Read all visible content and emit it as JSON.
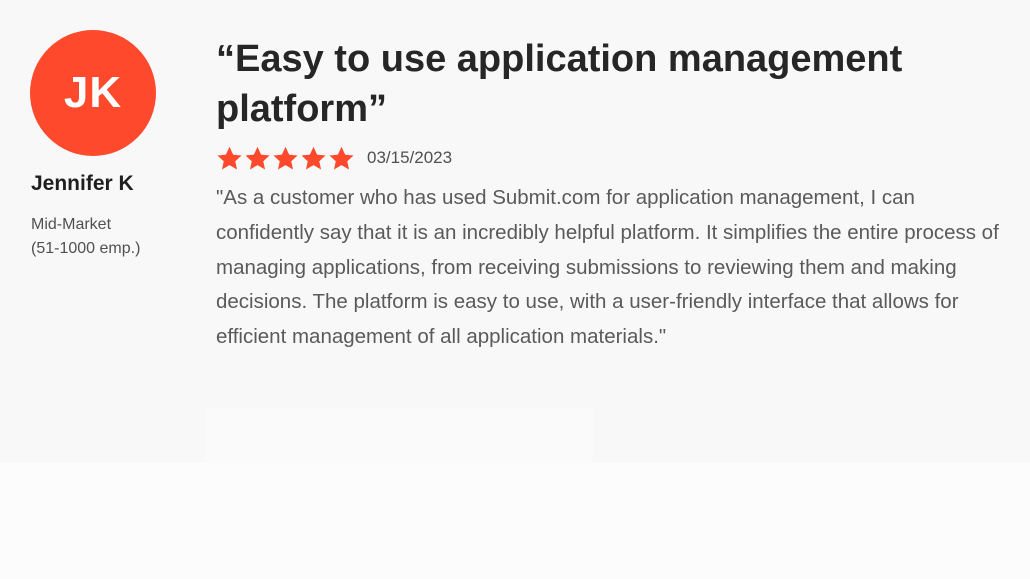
{
  "reviewer": {
    "initials": "JK",
    "name": "Jennifer K",
    "segment": "Mid-Market",
    "company_size": "(51-1000 emp.)",
    "avatar_color": "#ff492c"
  },
  "review": {
    "title": "“Easy to use application management platform”",
    "rating": 5,
    "rating_max": 5,
    "star_color": "#ff492c",
    "star_icon": "star-icon",
    "date": "03/15/2023",
    "body": "\"As a customer who has used Submit.com for application management, I can confidently say that it is an incredibly helpful platform. It simplifies the entire process of managing applications, from receiving submissions to reviewing them and making decisions. The platform is easy to use, with a user-friendly interface that allows for efficient management of all application materials.\""
  }
}
